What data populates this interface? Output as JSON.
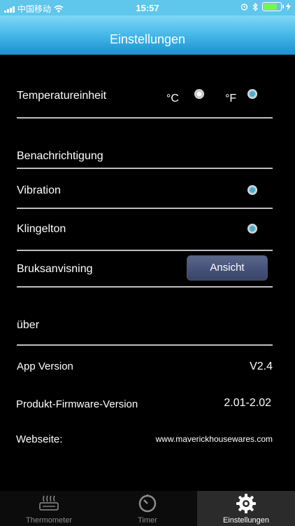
{
  "status": {
    "carrier": "中国移动",
    "time": "15:57",
    "battery_level": 0.85,
    "icons": [
      "signal-icon",
      "wifi-icon",
      "alarm-icon",
      "bluetooth-icon",
      "battery-icon",
      "charging-icon"
    ]
  },
  "nav": {
    "title": "Einstellungen"
  },
  "settings": {
    "temperature": {
      "label": "Temperatureinheit",
      "celsius": "°C",
      "fahrenheit": "°F"
    },
    "notification": {
      "label": "Benachrichtigung"
    },
    "vibration": {
      "label": "Vibration"
    },
    "ringtone": {
      "label": "Klingelton"
    },
    "manual": {
      "label": "Bruksanvisning",
      "button": "Ansicht"
    },
    "about": {
      "label": "über"
    },
    "app_version": {
      "label": "App Version",
      "value": "V2.4"
    },
    "firmware": {
      "label": "Produkt-Firmware-Version",
      "value": "2.01-2.02"
    },
    "website": {
      "label": "Webseite:",
      "value": "www.maverickhousewares.com"
    }
  },
  "tabs": [
    {
      "label": "Thermometer",
      "icon": "thermometer-icon"
    },
    {
      "label": "Timer",
      "icon": "timer-icon"
    },
    {
      "label": "Einstellungen",
      "icon": "gear-icon"
    }
  ],
  "colors": {
    "nav_blue": "#3fb4e6",
    "status_bar": "#5fc6ec",
    "button": "#4b577d",
    "battery_fill": "#7cf25a"
  }
}
